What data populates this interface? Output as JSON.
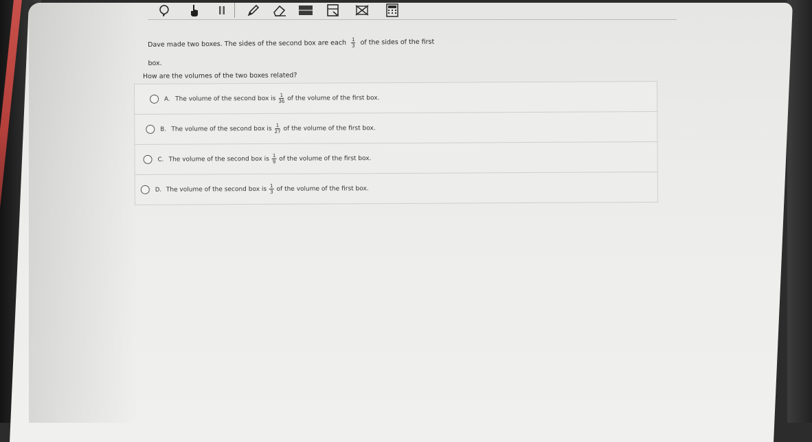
{
  "toolbar": {
    "tools": [
      {
        "icon": "speech-bubble-icon"
      },
      {
        "icon": "pointer-hand-icon"
      },
      {
        "icon": "pause-icon"
      },
      {
        "icon": "pencil-icon"
      },
      {
        "icon": "eraser-icon"
      },
      {
        "icon": "highlighter-icon"
      },
      {
        "icon": "line-reader-icon"
      },
      {
        "icon": "answer-eliminator-icon"
      },
      {
        "icon": "calculator-icon"
      }
    ]
  },
  "question": {
    "stem_part1": "Dave made two boxes. The sides of the second box are each",
    "stem_frac_num": "1",
    "stem_frac_den": "3",
    "stem_part2": "of the sides of the first",
    "stem_part3": "box.",
    "prompt": "How are the volumes of the two boxes related?"
  },
  "choices": [
    {
      "letter": "A.",
      "pre": "The volume of the second box is",
      "num": "1",
      "den": "36",
      "post": "of the volume of the first box."
    },
    {
      "letter": "B.",
      "pre": "The volume of the second box is",
      "num": "1",
      "den": "27",
      "post": "of the volume of the first box."
    },
    {
      "letter": "C.",
      "pre": "The volume of the second box is",
      "num": "1",
      "den": "9",
      "post": "of the volume of the first box."
    },
    {
      "letter": "D.",
      "pre": "The volume of the second box is",
      "num": "1",
      "den": "3",
      "post": "of the volume of the first box."
    }
  ]
}
